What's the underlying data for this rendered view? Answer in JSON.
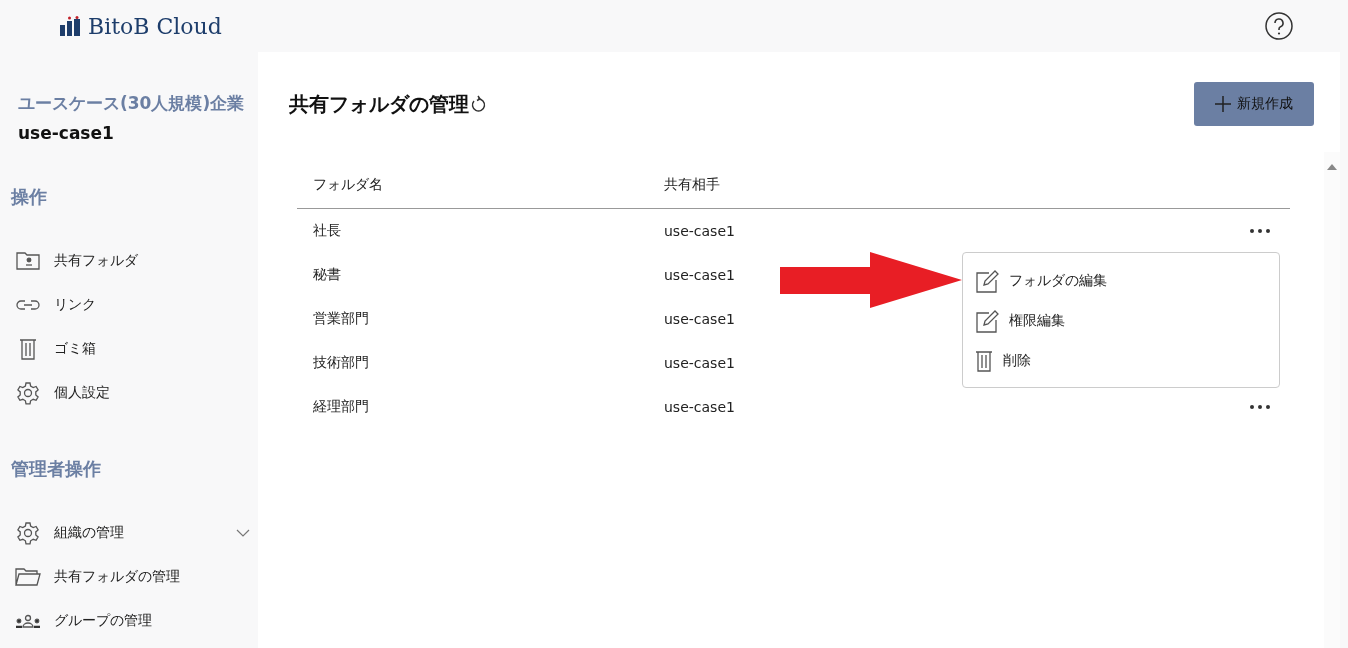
{
  "header": {
    "logo_text": "BitoB Cloud"
  },
  "sidebar": {
    "company": "ユースケース(30人規模)企業",
    "user": "use-case1",
    "sections": [
      {
        "title": "操作",
        "items": [
          {
            "label": "共有フォルダ",
            "kind": "shared"
          },
          {
            "label": "リンク",
            "kind": "link"
          },
          {
            "label": "ゴミ箱",
            "kind": "trash"
          },
          {
            "label": "個人設定",
            "kind": "settings"
          }
        ]
      },
      {
        "title": "管理者操作",
        "items": [
          {
            "label": "組織の管理",
            "kind": "settings",
            "expandable": true
          },
          {
            "label": "共有フォルダの管理",
            "kind": "folders"
          },
          {
            "label": "グループの管理",
            "kind": "groups"
          }
        ]
      }
    ]
  },
  "main": {
    "title": "共有フォルダの管理",
    "new_button": "新規作成",
    "table": {
      "columns": [
        "フォルダ名",
        "共有相手"
      ],
      "rows": [
        {
          "cells": [
            "社長",
            "use-case1"
          ],
          "more_icon": true
        },
        {
          "cells": [
            "秘書",
            "use-case1"
          ]
        },
        {
          "cells": [
            "営業部門",
            "use-case1"
          ]
        },
        {
          "cells": [
            "技術部門",
            "use-case1"
          ]
        },
        {
          "cells": [
            "経理部門",
            "use-case1"
          ],
          "more_icon": true
        }
      ]
    },
    "context_menu": [
      {
        "label": "フォルダの編集",
        "kind": "edit"
      },
      {
        "label": "権限編集",
        "kind": "edit"
      },
      {
        "label": "削除",
        "kind": "trash"
      }
    ]
  }
}
